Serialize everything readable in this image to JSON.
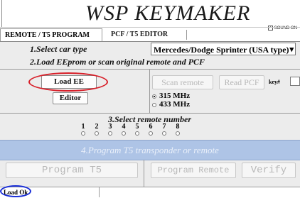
{
  "app": {
    "title": "WSP KEYMAKER"
  },
  "sound": {
    "label": "SOUND ON",
    "checked": true,
    "check_mark": "✓"
  },
  "tabs": [
    {
      "label": "REMOTE / T5 PROGRAM",
      "active": true
    },
    {
      "label": "PCF / T5 EDITOR",
      "active": false
    }
  ],
  "step1": {
    "label": "1.Select car type"
  },
  "car_type": {
    "value": "Mercedes/Dodge Sprinter (USA type)",
    "arrow": "▾"
  },
  "step2": {
    "label": "2.Load EEprom or scan original remote and PCF"
  },
  "buttons": {
    "load_ee": "Load EE",
    "editor": "Editor",
    "scan_remote": "Scan remote",
    "read_pcf": "Read PCF",
    "program_t5": "Program T5",
    "program_remote": "Program Remote",
    "verify": "Verify"
  },
  "frequency": {
    "options": [
      {
        "label": "315 MHz",
        "selected": true
      },
      {
        "label": "433 MHz",
        "selected": false
      }
    ]
  },
  "key_number": {
    "label": "key#",
    "value": ""
  },
  "step3": {
    "label": "3.Select remote number",
    "numbers": [
      "1",
      "2",
      "3",
      "4",
      "5",
      "6",
      "7",
      "8"
    ]
  },
  "step4": {
    "label": "4.Program T5 transponder or remote"
  },
  "status": {
    "text": "Load Ok"
  },
  "colors": {
    "accent_red": "#d8202a",
    "accent_blue": "#1a2fd8",
    "step4_bar": "#aec4e6"
  }
}
